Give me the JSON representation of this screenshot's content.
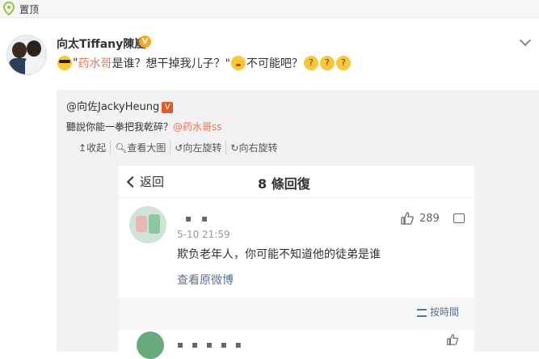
{
  "pinned": {
    "label": "置顶",
    "icon": "location-pin-icon"
  },
  "post": {
    "author": "向太Tiffany陳嵐",
    "verified_badge": "V",
    "text_before": "\"",
    "mention": "药水哥",
    "text_middle": "是谁？想干掉我儿子？\"",
    "text_after": "不可能吧？",
    "link_color": "#eb7350"
  },
  "retweet": {
    "user": "@向佐JackyHeung",
    "text": "聽說你能一拳把我乾碎？",
    "mention": "@药水哥ss",
    "toolbar": [
      "收起",
      "查看大图",
      "向左旋转",
      "向右旋转"
    ]
  },
  "screenshot": {
    "back_label": "返回",
    "title": "8 條回復",
    "comment": {
      "user": "▪ ▪",
      "time": "5-10 21:59",
      "text": "欺负老年人，你可能不知道他的徒弟是谁",
      "link": "查看原微博",
      "likes": "289"
    },
    "sort_label": "按時間",
    "comment2_user": "▪ ▪ ▪ ▪ ▪"
  }
}
